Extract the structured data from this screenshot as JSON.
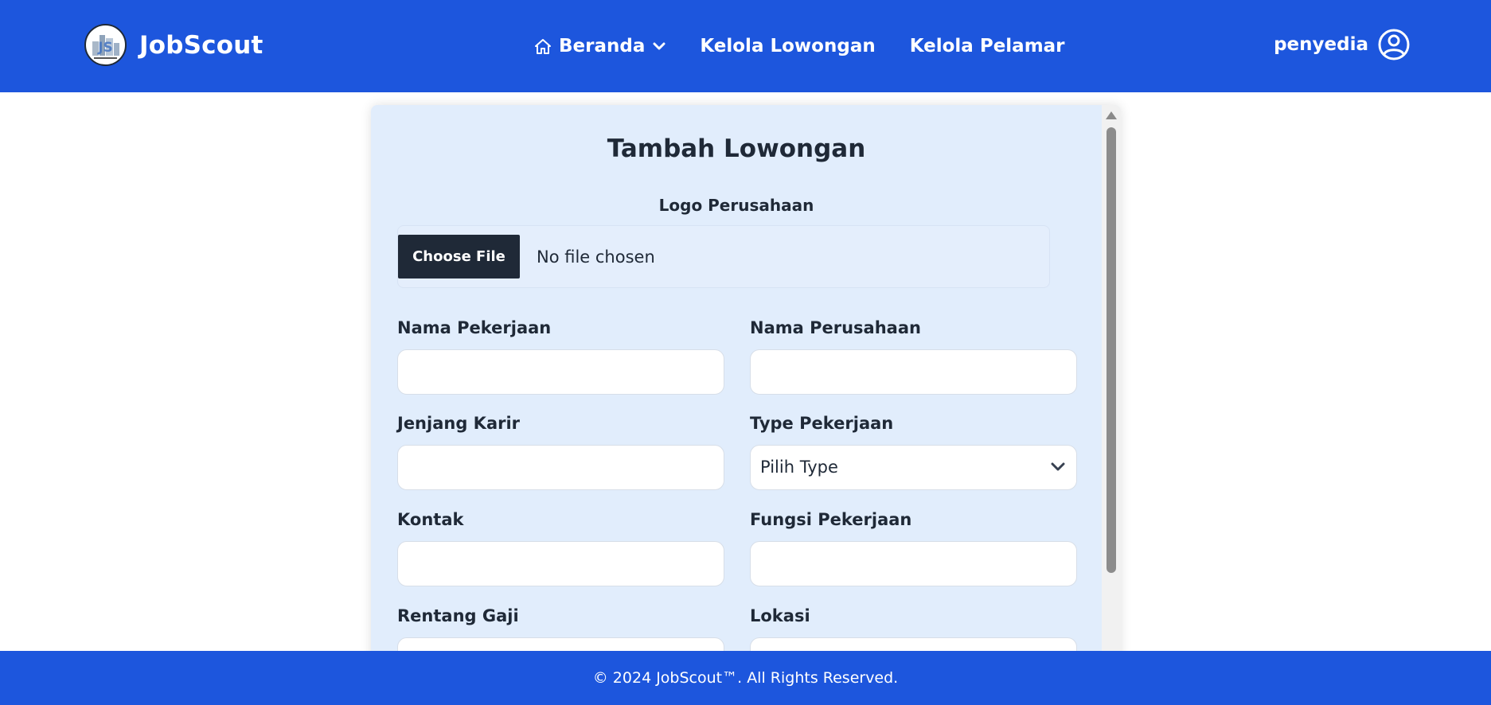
{
  "brand": {
    "name": "JobScout",
    "logo_text": "JS"
  },
  "nav": {
    "items": [
      {
        "label": "Beranda",
        "icon": "home-icon",
        "has_dropdown": true
      },
      {
        "label": "Kelola Lowongan"
      },
      {
        "label": "Kelola Pelamar"
      }
    ],
    "user": {
      "name": "penyedia",
      "icon": "user-circle-icon"
    }
  },
  "form": {
    "title": "Tambah Lowongan",
    "logo": {
      "label": "Logo Perusahaan",
      "button_label": "Choose File",
      "status": "No file chosen"
    },
    "fields": {
      "nama_pekerjaan": {
        "label": "Nama Pekerjaan",
        "value": ""
      },
      "nama_perusahaan": {
        "label": "Nama Perusahaan",
        "value": ""
      },
      "jenjang_karir": {
        "label": "Jenjang Karir",
        "value": ""
      },
      "type_pekerjaan": {
        "label": "Type Pekerjaan",
        "selected": "Pilih Type"
      },
      "kontak": {
        "label": "Kontak",
        "value": ""
      },
      "fungsi_pekerjaan": {
        "label": "Fungsi Pekerjaan",
        "value": ""
      },
      "rentang_gaji": {
        "label": "Rentang Gaji",
        "value": ""
      },
      "lokasi": {
        "label": "Lokasi",
        "value": ""
      }
    }
  },
  "footer": {
    "text": "© 2024 JobScout™. All Rights Reserved."
  },
  "colors": {
    "primary": "#1d56dd",
    "card_bg": "#e1edfc",
    "dark_button": "#1f2937",
    "text": "#1f2937"
  }
}
